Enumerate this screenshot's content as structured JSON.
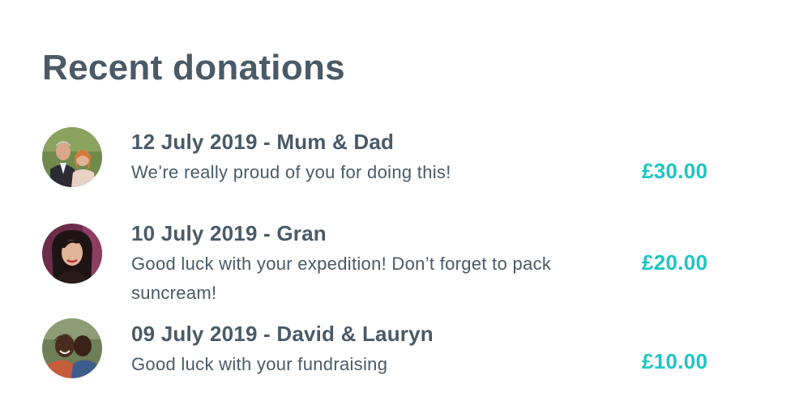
{
  "page": {
    "title": "Recent donations"
  },
  "colors": {
    "text": "#4a5a66",
    "amount": "#1cc5c2"
  },
  "donations": [
    {
      "date": "12 July 2019",
      "separator": " - ",
      "donor": "Mum & Dad",
      "heading": "12 July 2019 - Mum & Dad",
      "message": "We’re really proud of you for doing this!",
      "amount": "£30.00",
      "avatar": "couple-photo"
    },
    {
      "date": "10 July 2019",
      "separator": " - ",
      "donor": "Gran",
      "heading": "10 July 2019 - Gran",
      "message": "Good luck with your expedition! Don’t forget to pack suncream!",
      "amount": "£20.00",
      "avatar": "woman-photo"
    },
    {
      "date": "09 July 2019",
      "separator": " - ",
      "donor": "David & Lauryn",
      "heading": "09 July 2019 - David & Lauryn",
      "message": "Good luck with your fundraising",
      "amount": "£10.00",
      "avatar": "couple-embrace-photo"
    }
  ]
}
